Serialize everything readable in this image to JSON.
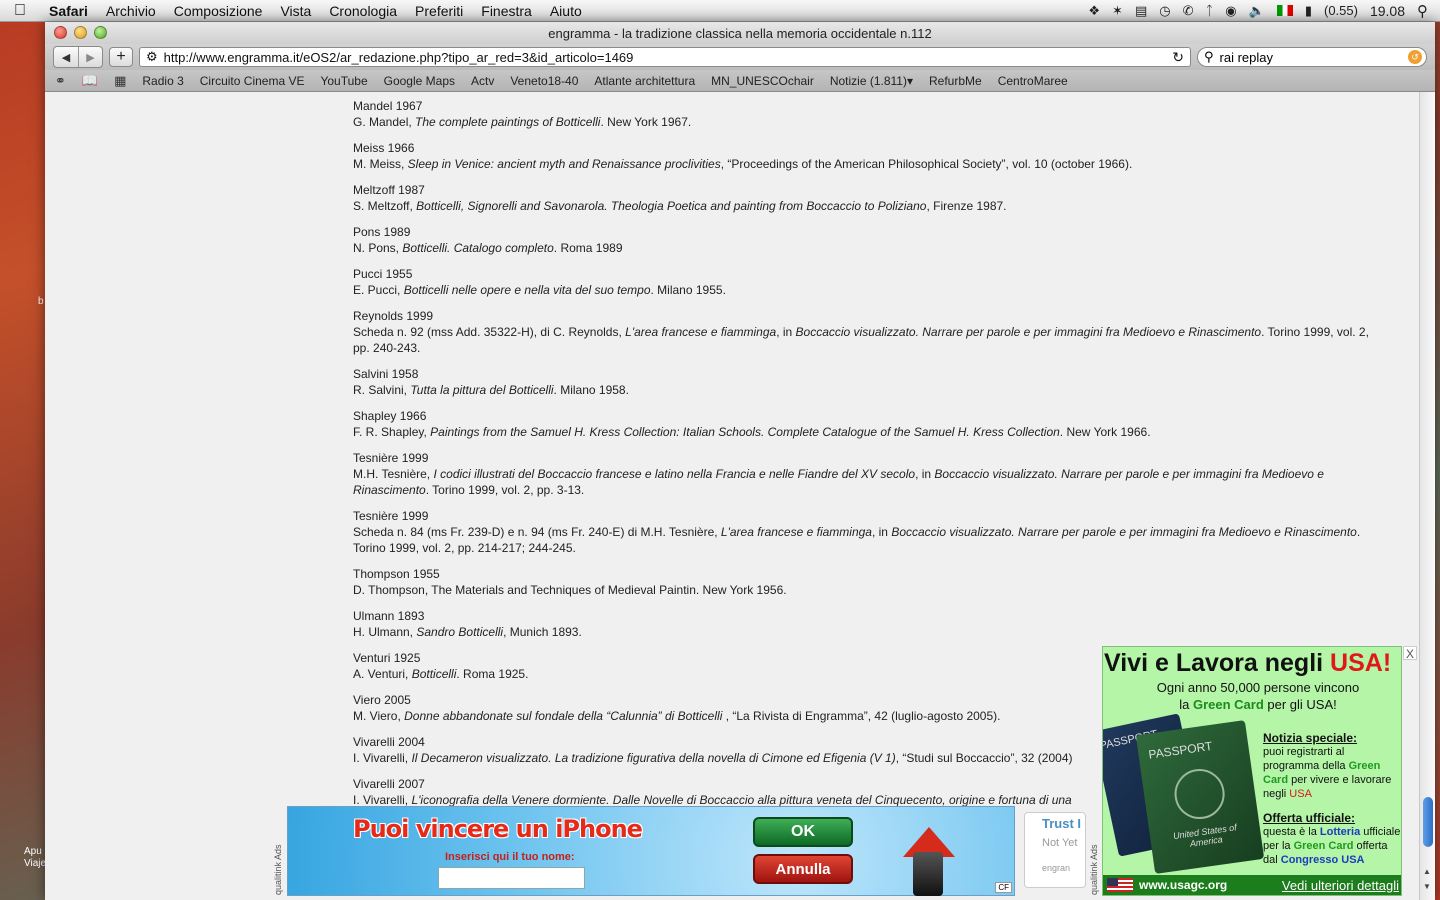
{
  "menubar": {
    "app": "Safari",
    "items": [
      "Archivio",
      "Composizione",
      "Vista",
      "Cronologia",
      "Preferiti",
      "Finestra",
      "Aiuto"
    ],
    "battery": "(0.55)",
    "clock": "19.08"
  },
  "window": {
    "title": "engramma - la tradizione classica nella memoria occidentale n.112",
    "url": "http://www.engramma.it/eOS2/ar_redazione.php?tipo_ar_red=3&id_articolo=1469",
    "search": "rai replay"
  },
  "bookmarks": [
    "Radio 3",
    "Circuito Cinema VE",
    "YouTube",
    "Google Maps",
    "Actv",
    "Veneto18-40",
    "Atlante architettura",
    "MN_UNESCOchair",
    "Notizie (1.811)▾",
    "RefurbMe",
    "CentroMaree"
  ],
  "references": [
    {
      "head": "Mandel 1967",
      "pre": "G. Mandel, ",
      "it": "The complete paintings of Botticelli",
      "post": ". New York 1967."
    },
    {
      "head": "Meiss 1966",
      "pre": "M. Meiss, ",
      "it": "Sleep in Venice: ancient myth and Renaissance proclivities",
      "post": ", “Proceedings of the American Philosophical Society”, vol. 10 (october 1966)."
    },
    {
      "head": "Meltzoff 1987",
      "pre": "S. Meltzoff, ",
      "it": "Botticelli, Signorelli and Savonarola. Theologia Poetica and painting from Boccaccio to Poliziano",
      "post": ", Firenze 1987."
    },
    {
      "head": "Pons 1989",
      "pre": "N. Pons, ",
      "it": "Botticelli. Catalogo completo",
      "post": ". Roma 1989"
    },
    {
      "head": "Pucci 1955",
      "pre": "E. Pucci, ",
      "it": "Botticelli nelle opere e nella vita del suo tempo",
      "post": ". Milano 1955."
    },
    {
      "head": "Reynolds 1999",
      "pre": "Scheda n. 92 (mss Add. 35322-H), di C. Reynolds, ",
      "it": "L'area francese e fiamminga",
      "mid": ", in ",
      "it2": "Boccaccio visualizzato. Narrare per parole e per immagini fra Medioevo e Rinascimento",
      "post": ". Torino 1999, vol. 2, pp. 240-243."
    },
    {
      "head": "Salvini 1958",
      "pre": "R. Salvini, ",
      "it": "Tutta la pittura del Botticelli",
      "post": ". Milano 1958."
    },
    {
      "head": "Shapley 1966",
      "pre": "F. R. Shapley, ",
      "it": "Paintings from the Samuel H. Kress Collection: Italian Schools. Complete Catalogue of the Samuel H. Kress Collection",
      "post": ". New York 1966."
    },
    {
      "head": "Tesnière 1999",
      "pre": "M.H. Tesnière, ",
      "it": "I codici illustrati del Boccaccio francese e latino nella Francia e nelle Fiandre del XV secolo",
      "mid": ", in ",
      "it2": "Boccaccio visualizzato. Narrare per parole e per immagini fra Medioevo e Rinascimento",
      "post": ". Torino 1999, vol. 2, pp. 3-13."
    },
    {
      "head": "Tesnière 1999",
      "pre": "Scheda n. 84 (ms Fr. 239-D) e n. 94 (ms Fr. 240-E) di M.H. Tesnière, ",
      "it": "L'area francese e fiamminga",
      "mid": ", in ",
      "it2": "Boccaccio visualizzato. Narrare per parole e per immagini fra Medioevo e Rinascimento",
      "post": ". Torino 1999, vol. 2, pp. 214-217; 244-245."
    },
    {
      "head": "Thompson 1955",
      "pre": "D. Thompson, The Materials and Techniques of Medieval Paintin. New York 1956.",
      "it": "",
      "post": ""
    },
    {
      "head": "Ulmann 1893",
      "pre": "H. Ulmann, ",
      "it": "Sandro Botticelli",
      "post": ", Munich 1893."
    },
    {
      "head": "Venturi 1925",
      "pre": "A. Venturi, ",
      "it": "Botticelli",
      "post": ". Roma 1925."
    },
    {
      "head": "Viero 2005",
      "pre": "M. Viero, ",
      "it": "Donne abbandonate sul fondale della “Calunnia” di Botticelli",
      "post": " , “La Rivista di Engramma”, 42 (luglio-agosto 2005)."
    },
    {
      "head": "Vivarelli 2004",
      "pre": "I. Vivarelli, ",
      "it": "Il Decameron visualizzato. La tradizione figurativa della novella di Cimone ed Efigenia (V 1)",
      "post": ", “Studi sul Boccaccio”, 32 (2004)"
    },
    {
      "head": "Vivarelli 2007",
      "pre": "I. Vivarelli, ",
      "it": "L'iconografia della Venere dormiente. Dalle Novelle di Boccaccio alla pittura veneta del Cinquecento, origine e fortuna di una",
      "post": ""
    }
  ],
  "ad_bottom": {
    "title": "Puoi vincere un iPhone",
    "label": "Inserisci qui il tuo nome:",
    "ok": "OK",
    "cancel": "Annulla",
    "cf": "CF",
    "vlabel": "qualitink Ads"
  },
  "trust": {
    "t1": "Trust I",
    "t2": "Not Yet",
    "t3": "engran"
  },
  "ad_right": {
    "close": "X",
    "h1": "Vivi e Lavora negli ",
    "h1_usa": "USA!",
    "sub1": "Ogni anno 50,000 persone vincono",
    "sub2a": "la ",
    "sub2_gc": "Green Card",
    "sub2b": " per gli USA!",
    "p1_label": "PASSPORT",
    "p2_label": "PASSPORT",
    "p2_us": "United States of America",
    "notizia": "Notizia speciale:",
    "notizia_text1": "puoi registrarti al programma della ",
    "notizia_gc": "Green Card",
    "notizia_text2": " per vivere e lavorare negli ",
    "notizia_usa": "USA",
    "offerta": "Offerta ufficiale:",
    "offerta_text1": "questa è la ",
    "offerta_lotteria": "Lotteria",
    "offerta_text2": " ufficiale per la ",
    "offerta_gc": "Green Card",
    "offerta_text3": " offerta dal ",
    "offerta_congresso": "Congresso USA",
    "site": "www.usagc.org",
    "more": "Vedi ulteriori dettagli",
    "vlabel": "qualitink Ads"
  },
  "desktop": {
    "b": "b",
    "label1": "Apu",
    "label2": "Viaje"
  }
}
